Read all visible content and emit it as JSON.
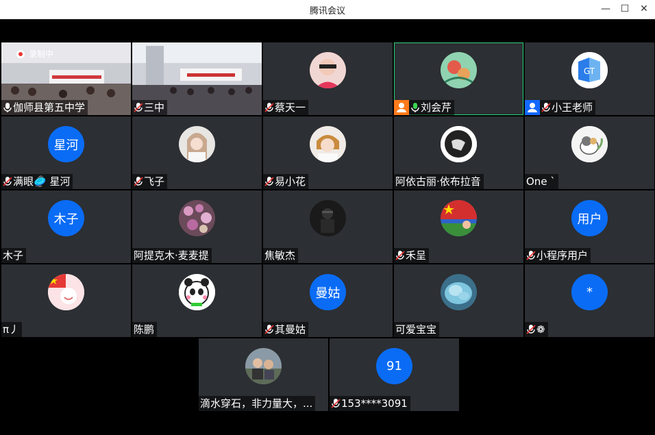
{
  "window": {
    "title": "腾讯会议"
  },
  "recording_label": "录制中",
  "participants": [
    {
      "name": "伽师县第五中学",
      "mic": "on"
    },
    {
      "name": "三中",
      "mic": "muted"
    },
    {
      "name": "蔡天一",
      "mic": "muted"
    },
    {
      "name": "刘会芹",
      "mic": "on",
      "role": "host"
    },
    {
      "name": "小王老师",
      "mic": "muted",
      "role": "cohost"
    },
    {
      "name": "满眼🥏 星河",
      "mic": "muted",
      "avatar_text": "星河"
    },
    {
      "name": "飞子",
      "mic": "muted"
    },
    {
      "name": "易小花",
      "mic": "muted"
    },
    {
      "name": "阿依古丽·依布拉音",
      "mic": "none"
    },
    {
      "name": "One `",
      "mic": "none"
    },
    {
      "name": "木子",
      "mic": "none",
      "avatar_text": "木子"
    },
    {
      "name": "阿提克木·麦麦提",
      "mic": "none"
    },
    {
      "name": "焦敏杰",
      "mic": "none"
    },
    {
      "name": "禾呈",
      "mic": "muted"
    },
    {
      "name": "小程序用户",
      "mic": "muted",
      "avatar_text": "用户"
    },
    {
      "name": "π丿",
      "mic": "none"
    },
    {
      "name": "陈鹏",
      "mic": "none"
    },
    {
      "name": "其曼姑",
      "mic": "muted",
      "avatar_text": "曼姑"
    },
    {
      "name": "可爱宝宝",
      "mic": "none"
    },
    {
      "name": "❁",
      "mic": "muted",
      "avatar_text": "*"
    },
    {
      "name": "滴水穿石，非力量大，...",
      "mic": "none"
    },
    {
      "name": "153****3091",
      "mic": "muted",
      "avatar_text": "91"
    }
  ],
  "colors": {
    "tile_bg": "#2c2f33",
    "avatar_blue": "#0a6cf5",
    "active_border": "#2ad17a",
    "host_badge": "#ff7a1a",
    "cohost_badge": "#1268ff"
  }
}
